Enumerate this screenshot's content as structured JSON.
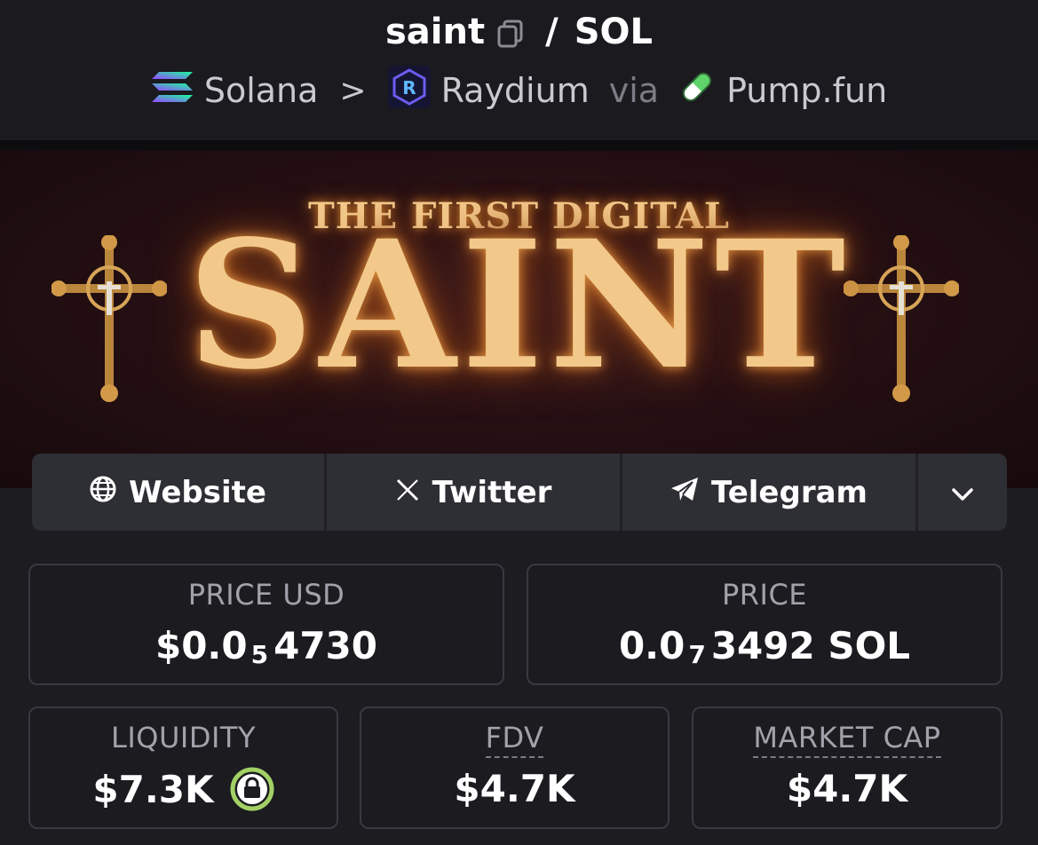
{
  "header": {
    "token": "saint",
    "separator": "/",
    "quote": "SOL",
    "chain": "Solana",
    "chevron": ">",
    "dex": "Raydium",
    "via": "via",
    "launchpad": "Pump.fun"
  },
  "banner": {
    "subtitle": "THE FIRST DIGITAL",
    "title": "SAINT"
  },
  "links": {
    "website": "Website",
    "twitter": "Twitter",
    "telegram": "Telegram"
  },
  "stats": {
    "price_usd": {
      "label": "PRICE USD",
      "prefix": "$0.0",
      "zeros": "5",
      "digits": "4730"
    },
    "price": {
      "label": "PRICE",
      "prefix": "0.0",
      "zeros": "7",
      "digits": "3492 SOL"
    },
    "liquidity": {
      "label": "LIQUIDITY",
      "value": "$7.3K"
    },
    "fdv": {
      "label": "FDV",
      "value": "$4.7K"
    },
    "market_cap": {
      "label": "MARKET CAP",
      "value": "$4.7K"
    }
  },
  "colors": {
    "background": "#1c1c21",
    "card_border": "#393941",
    "label": "#a2a2ab",
    "lock_accent": "#a3d165",
    "banner_glow": "#f2c98a"
  },
  "icons": [
    "copy-icon",
    "solana-icon",
    "raydium-icon",
    "pill-icon",
    "globe-icon",
    "x-icon",
    "telegram-icon",
    "chevron-down-icon",
    "lock-icon",
    "cross-icon"
  ]
}
